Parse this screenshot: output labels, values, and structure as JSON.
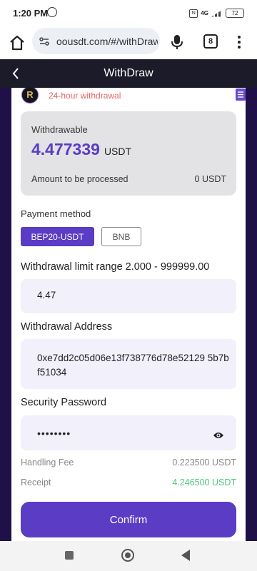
{
  "status": {
    "time": "1:20 PM",
    "network": "4G",
    "battery": "72"
  },
  "browser": {
    "url": "oousdt.com/#/withDraw",
    "tab_count": "8"
  },
  "header": {
    "title": "WithDraw"
  },
  "notice": {
    "logo_letter": "R",
    "text": "24-hour withdrawal"
  },
  "balance": {
    "label": "Withdrawable",
    "amount": "4.477339",
    "currency": "USDT",
    "processing_label": "Amount to be processed",
    "processing_value": "0 USDT"
  },
  "payment": {
    "label": "Payment method",
    "options": [
      {
        "label": "BEP20-USDT",
        "selected": true
      },
      {
        "label": "BNB",
        "selected": false
      }
    ]
  },
  "limit": {
    "label": "Withdrawal limit range 2.000 - 999999.00",
    "value": "4.47"
  },
  "address": {
    "label": "Withdrawal Address",
    "value": "0xe7dd2c05d06e13f738776d78e52129 5b7bf51034"
  },
  "password": {
    "label": "Security Password",
    "value": "••••••••"
  },
  "summary": {
    "fee_label": "Handling Fee",
    "fee_value": "0.223500 USDT",
    "receipt_label": "Receipt",
    "receipt_value": "4.246500 USDT"
  },
  "confirm_label": "Confirm",
  "colors": {
    "accent": "#5b3cc4",
    "header_bg": "#1b1b29",
    "frame_bg": "#1f1047",
    "receipt": "#4cc77a",
    "notice": "#e06666"
  }
}
